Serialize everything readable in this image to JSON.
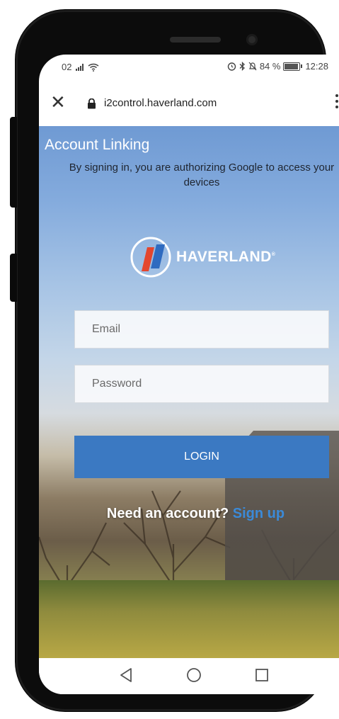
{
  "status_bar": {
    "carrier": "02",
    "battery_percent": "84 %",
    "time": "12:28"
  },
  "browser": {
    "url": "i2control.haverland.com",
    "close_icon": "close-icon",
    "lock_icon": "lock-icon",
    "menu_icon": "more-vertical-icon"
  },
  "page": {
    "title": "Account Linking",
    "subtitle": "By signing in, you are authorizing Google to access your devices",
    "brand": "HAVERLAND",
    "brand_mark": "®",
    "email_placeholder": "Email",
    "password_placeholder": "Password",
    "login_label": "LOGIN",
    "signup_prompt": "Need an account?",
    "signup_link": "Sign up"
  },
  "colors": {
    "login_button": "#3b79c2",
    "signup_link": "#3b8ad8",
    "logo_red": "#e3462e",
    "logo_blue": "#2f6bc0"
  },
  "nav": {
    "back_icon": "triangle-back-icon",
    "home_icon": "circle-home-icon",
    "recents_icon": "square-recents-icon"
  }
}
